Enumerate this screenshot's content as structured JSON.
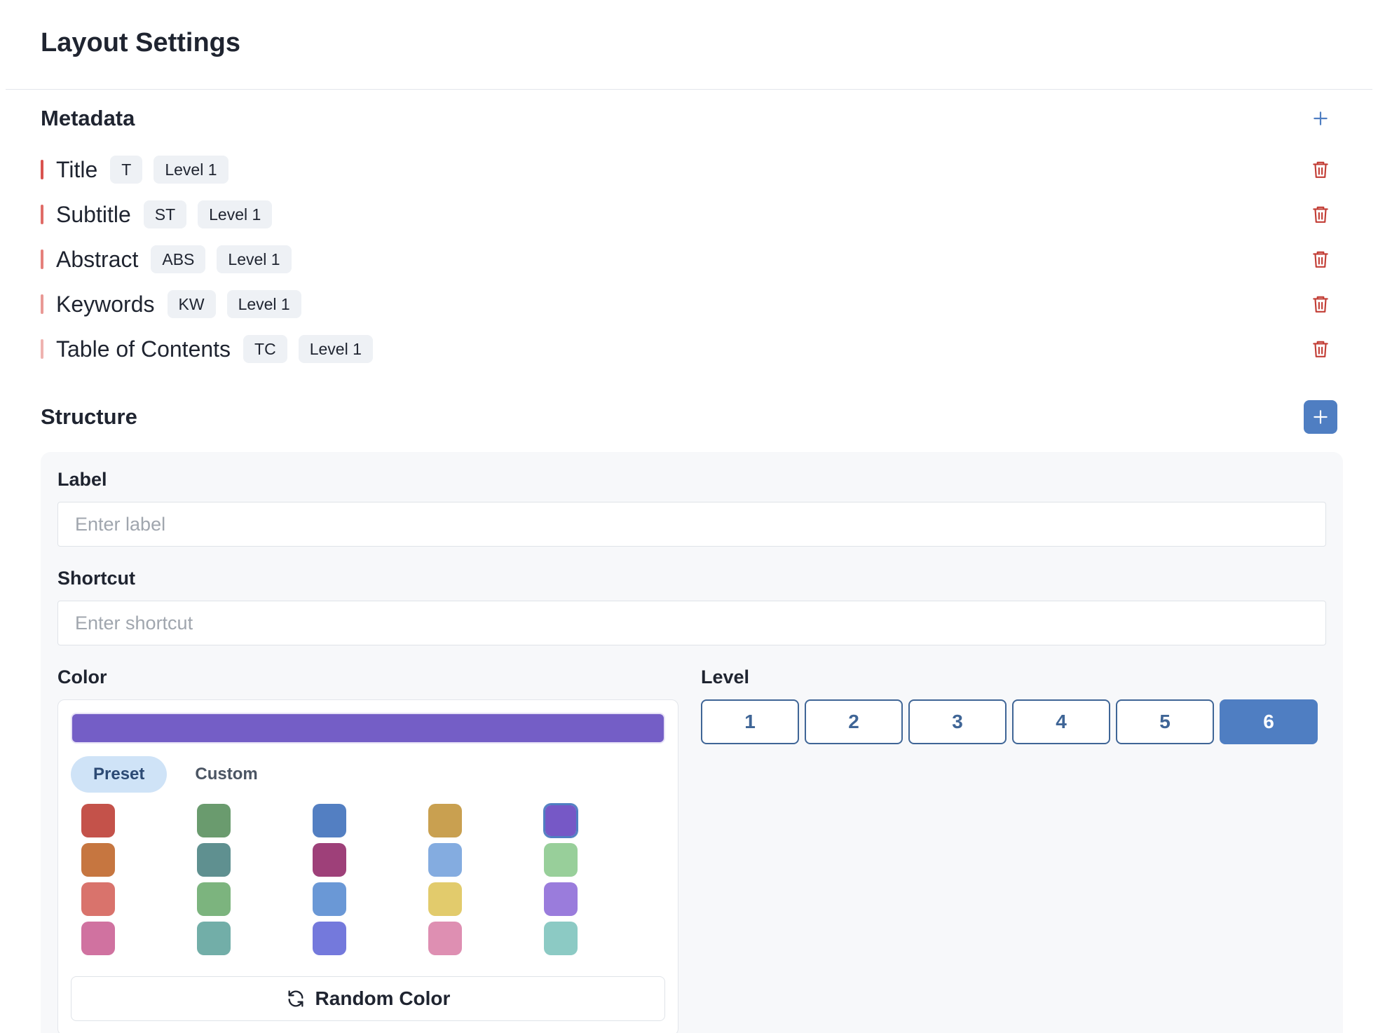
{
  "header": {
    "title": "Layout Settings"
  },
  "metadata": {
    "title": "Metadata",
    "add_icon": "plus-icon",
    "items": [
      {
        "label": "Title",
        "shortcut": "T",
        "level": "Level 1",
        "color": "#d9534f"
      },
      {
        "label": "Subtitle",
        "shortcut": "ST",
        "level": "Level 1",
        "color": "#e06c67"
      },
      {
        "label": "Abstract",
        "shortcut": "ABS",
        "level": "Level 1",
        "color": "#e5807b"
      },
      {
        "label": "Keywords",
        "shortcut": "KW",
        "level": "Level 1",
        "color": "#e99995"
      },
      {
        "label": "Table of Contents",
        "shortcut": "TC",
        "level": "Level 1",
        "color": "#efb3b0"
      }
    ],
    "delete_icon": "trash-icon"
  },
  "structure": {
    "title": "Structure",
    "add_icon": "plus-icon",
    "label_field": {
      "label": "Label",
      "placeholder": "Enter label",
      "value": ""
    },
    "shortcut_field": {
      "label": "Shortcut",
      "placeholder": "Enter shortcut",
      "value": ""
    },
    "color": {
      "label": "Color",
      "selected": "#745ec6",
      "tabs": [
        "Preset",
        "Custom"
      ],
      "active_tab": "Preset",
      "swatches": [
        "#c4524a",
        "#6a9b6e",
        "#537fc2",
        "#c9a050",
        "#7658c6",
        "#c67640",
        "#5f9090",
        "#9e4079",
        "#84ace0",
        "#98cf9a",
        "#d9736c",
        "#7cb47e",
        "#6a98d6",
        "#e2cb6c",
        "#9a7cdc",
        "#d072a0",
        "#72aea8",
        "#7479dc",
        "#de8fb2",
        "#8ccac4"
      ],
      "random_button": "Random Color",
      "random_icon": "refresh-icon"
    },
    "level": {
      "label": "Level",
      "options": [
        "1",
        "2",
        "3",
        "4",
        "5",
        "6"
      ],
      "selected": "6"
    }
  }
}
